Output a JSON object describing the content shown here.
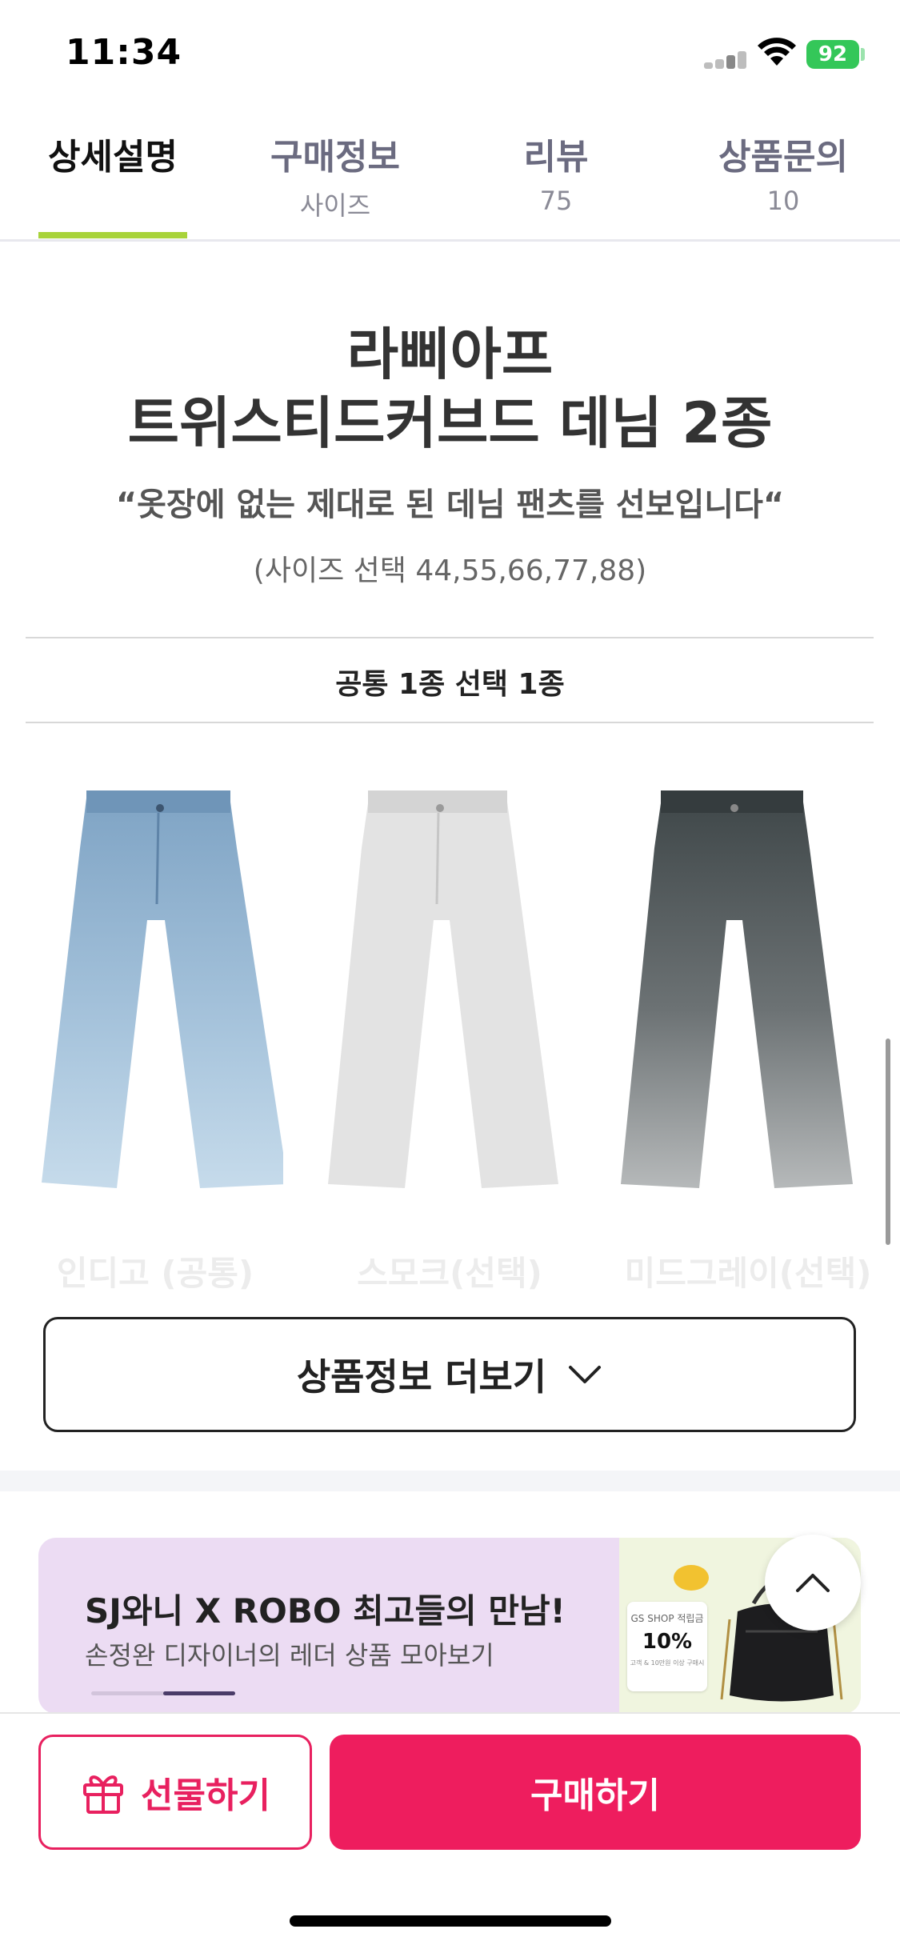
{
  "status_bar": {
    "time": "11:34",
    "battery": "92"
  },
  "tabs": [
    {
      "label": "상세설명",
      "sub": ""
    },
    {
      "label": "구매정보",
      "sub": "사이즈"
    },
    {
      "label": "리뷰",
      "sub": "75"
    },
    {
      "label": "상품문의",
      "sub": "10"
    }
  ],
  "product": {
    "brand": "라삐아프",
    "name": "트위스티드커브드 데님 2종",
    "tagline": "“옷장에 없는 제대로 된 데님 팬츠를 선보입니다“",
    "sizes": "(사이즈 선택 44,55,66,77,88)",
    "option_note": "공통 1종 선택 1종",
    "colors": [
      "인디고 (공통)",
      "스모크(선택)",
      "미드그레이(선택)"
    ],
    "more_button": "상품정보 더보기"
  },
  "banner": {
    "title": "SJ와니 X ROBO 최고들의 만남!",
    "subtitle": "손정완 디자이너의 레더 상품 모아보기",
    "gs_title": "GS SHOP 적립금",
    "gs_percent": "10%",
    "gs_note": "고객 & 10만원 이상 구매시"
  },
  "bottom": {
    "gift_label": "선물하기",
    "buy_label": "구매하기"
  },
  "colors": {
    "accent": "#ee1d5e",
    "tab_indicator": "#a8d33a",
    "battery": "#34c759"
  }
}
